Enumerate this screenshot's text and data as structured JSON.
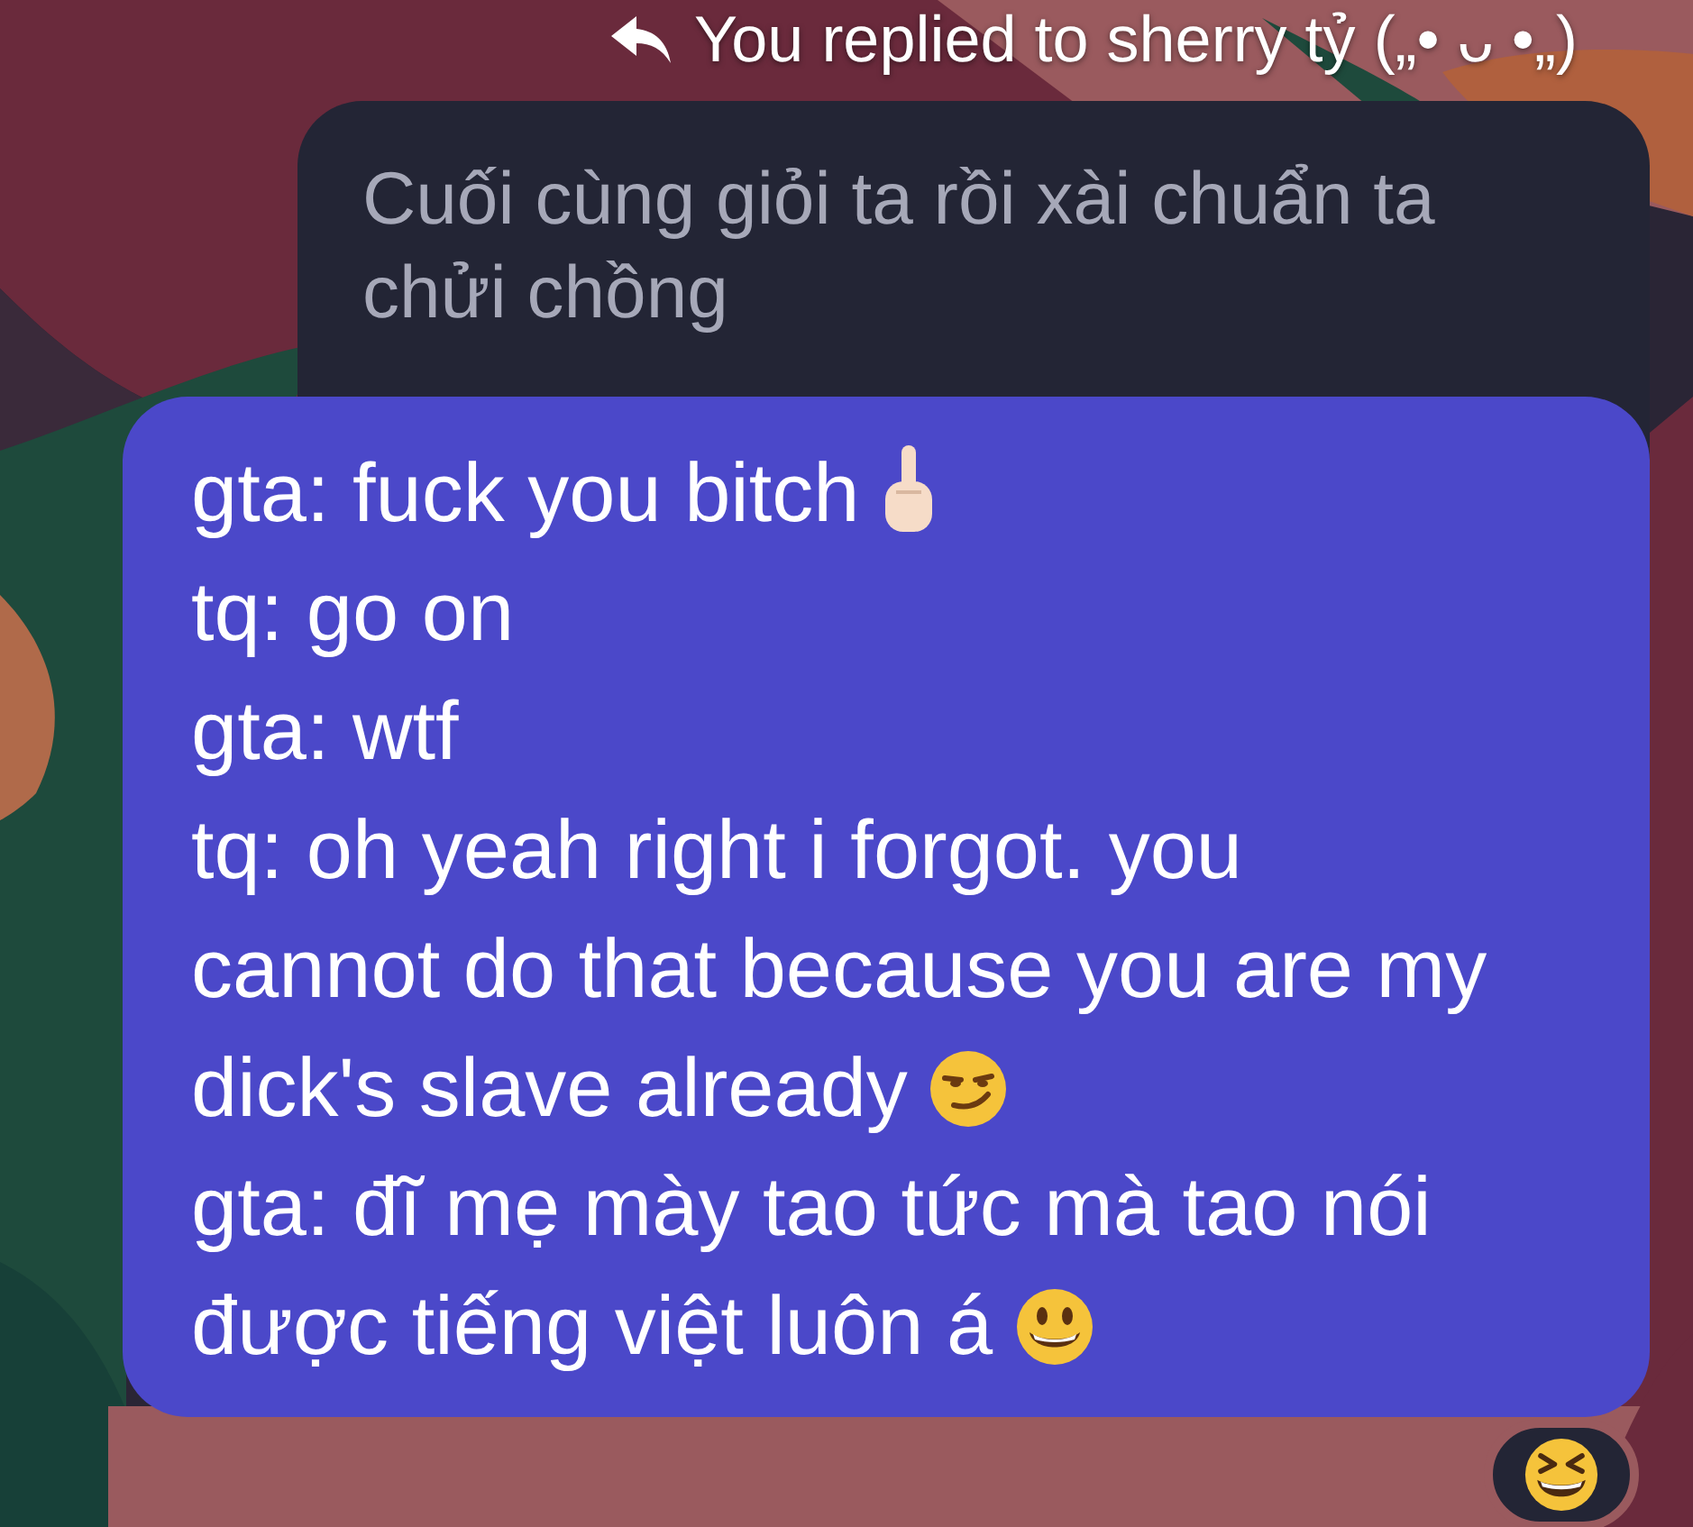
{
  "reply_header": {
    "text": "You replied to sherry tỷ („• ᴗ •„)"
  },
  "quoted_message": {
    "text": "Cuối cùng giỏi ta rồi xài chuẩn ta chửi chồng"
  },
  "message": {
    "paragraphs": [
      {
        "text": "gta: fuck you bitch",
        "kind": "hand"
      },
      {
        "text": "tq: go on",
        "kind": "text"
      },
      {
        "text": "gta: wtf",
        "kind": "text"
      },
      {
        "text": "tq: oh yeah right i forgot. you cannot do that because you are my dick's slave already",
        "kind": "smirk"
      },
      {
        "text": "gta: đĩ mẹ mày tao tức mà tao nói được tiếng việt luôn á",
        "kind": "grin"
      }
    ]
  },
  "reaction": {
    "kind": "laugh"
  }
}
